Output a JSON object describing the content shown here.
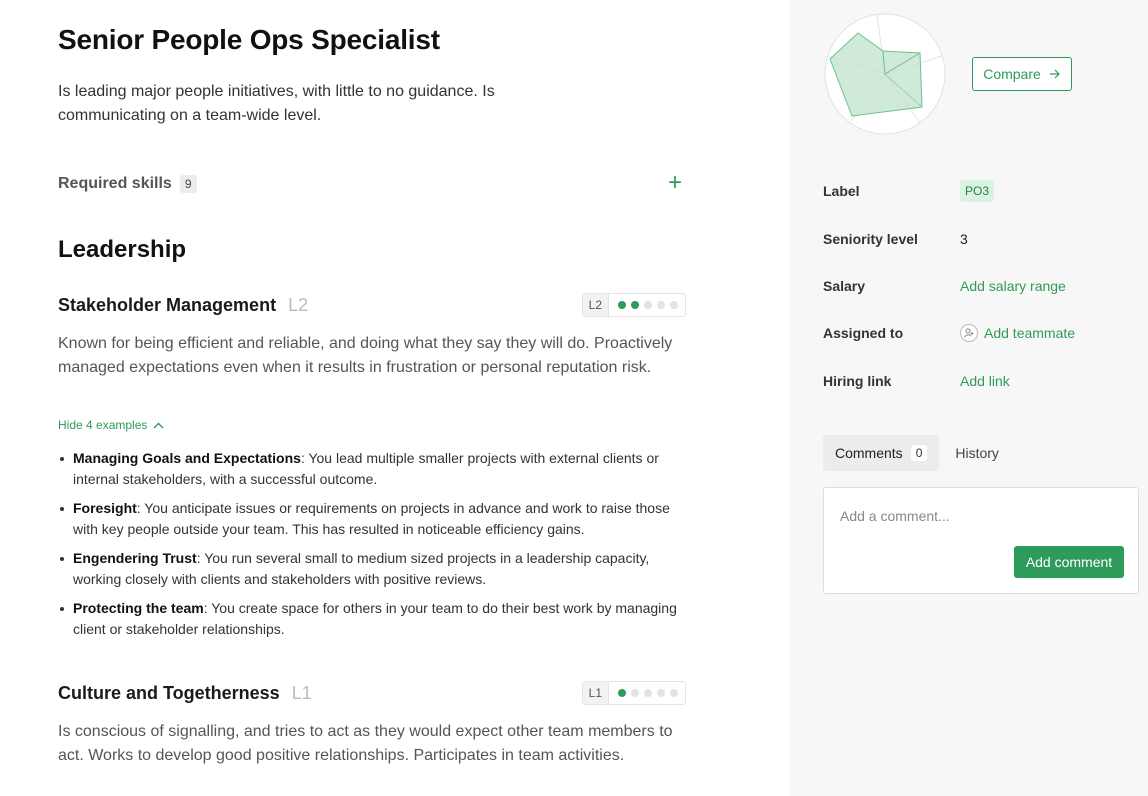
{
  "role": {
    "title": "Senior People Ops Specialist",
    "description": "Is leading major people initiatives, with little to no guidance. Is communicating on a team-wide level."
  },
  "required_skills": {
    "label": "Required skills",
    "count": "9",
    "add_icon": "plus-icon"
  },
  "section": {
    "title": "Leadership"
  },
  "skills": [
    {
      "name": "Stakeholder Management",
      "level": "L2",
      "level_tag": "L2",
      "level_value": 2,
      "level_max": 5,
      "description": "Known for being efficient and reliable, and doing what they say they will do. Proactively managed expectations even when it results in frustration or personal reputation risk.",
      "toggle_label": "Hide 4 examples",
      "toggle_icon": "chevron-up-icon",
      "examples": [
        {
          "title": "Managing Goals and Expectations",
          "text": ": You lead multiple smaller projects with external clients or internal stakeholders, with a successful outcome."
        },
        {
          "title": "Foresight",
          "text": ": You anticipate issues or requirements on projects in advance and work to raise those with key people outside your team. This has resulted in noticeable efficiency gains."
        },
        {
          "title": "Engendering Trust",
          "text": ": You run several small to medium sized projects in a leadership capacity, working closely with clients and stakeholders with positive reviews."
        },
        {
          "title": "Protecting the team",
          "text": ": You create space for others in your team to do their best work by managing client or stakeholder relationships."
        }
      ]
    },
    {
      "name": "Culture and Togetherness",
      "level": "L1",
      "level_tag": "L1",
      "level_value": 1,
      "level_max": 5,
      "description": "Is conscious of signalling, and tries to act as they would expect other team members to act. Works to develop good positive relationships. Participates in team activities."
    }
  ],
  "sidebar": {
    "compare_label": "Compare",
    "compare_icon": "arrow-right-icon",
    "properties": [
      {
        "key": "Label",
        "value": "PO3",
        "kind": "badge"
      },
      {
        "key": "Seniority level",
        "value": "3",
        "kind": "text"
      },
      {
        "key": "Salary",
        "value": "Add salary range",
        "kind": "link"
      },
      {
        "key": "Assigned to",
        "value": "Add teammate",
        "kind": "link-icon",
        "icon": "add-user-icon"
      },
      {
        "key": "Hiring link",
        "value": "Add link",
        "kind": "link"
      }
    ],
    "tabs": {
      "comments_label": "Comments",
      "comments_count": "0",
      "history_label": "History"
    },
    "comment": {
      "placeholder": "Add a comment...",
      "submit_label": "Add comment"
    }
  },
  "colors": {
    "accent": "#2e9b5b",
    "badge_bg": "#d9f2e1",
    "sidebar_bg": "#f7f7f7",
    "radar_fill": "#bfe3cb"
  }
}
